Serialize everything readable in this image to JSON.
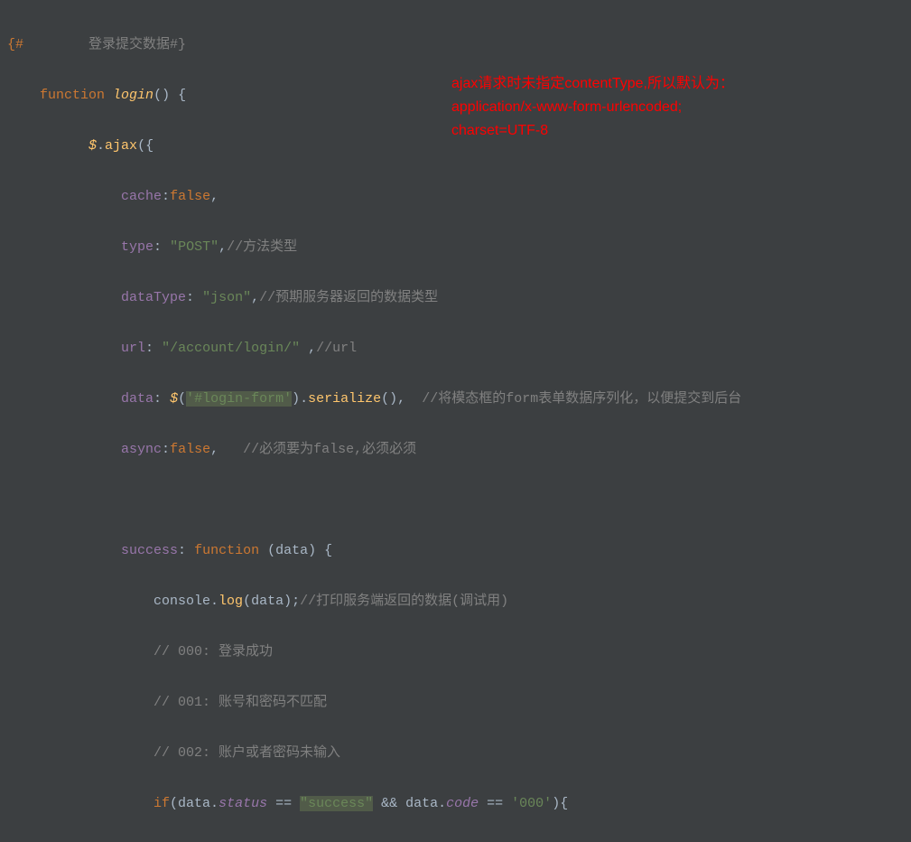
{
  "annotation": {
    "line1": "ajax请求时未指定contentType,所以默认为：",
    "line2": "application/x-www-form-urlencoded;",
    "line3": "charset=UTF-8"
  },
  "code": {
    "l1": {
      "open": "{#",
      "text": "登录提交数据#}"
    },
    "l2": {
      "kw": "function",
      "name": "login",
      "parens": "()",
      "brace": "{"
    },
    "l3": {
      "jq": "$",
      "method": "ajax",
      "paren": "(",
      "brace": "{"
    },
    "l4": {
      "prop": "cache",
      "colon": ":",
      "val": "false",
      "comma": ","
    },
    "l5": {
      "prop": "type",
      "colon": ": ",
      "val": "\"POST\"",
      "comma": ",",
      "comment": "//方法类型"
    },
    "l6": {
      "prop": "dataType",
      "colon": ": ",
      "val": "\"json\"",
      "comma": ",",
      "comment": "//预期服务器返回的数据类型"
    },
    "l7": {
      "prop": "url",
      "colon": ": ",
      "val": "\"/account/login/\"",
      "spc": " ",
      "comma": ",",
      "comment": "//url"
    },
    "l8": {
      "prop": "data",
      "colon": ": ",
      "jq": "$",
      "p1": "(",
      "sel": "'#login-form'",
      "p2": ").",
      "meth": "serialize",
      "p3": "(),",
      "comment": "//将模态框的form表单数据序列化，以便提交到后台"
    },
    "l9": {
      "prop": "async",
      "colon": ":",
      "val": "false",
      "comma": ",",
      "comment": "//必须要为false,必须必须"
    },
    "l11": {
      "prop": "success",
      "colon": ": ",
      "kw": "function",
      "args": "(data)",
      "brace": "{"
    },
    "l12": {
      "obj": "console.",
      "meth": "log",
      "p1": "(data);",
      "comment": "//打印服务端返回的数据(调试用)"
    },
    "l13": {
      "comment": "// 000: 登录成功"
    },
    "l14": {
      "comment": "// 001: 账号和密码不匹配"
    },
    "l15": {
      "comment": "// 002: 账户或者密码未输入"
    },
    "l16": {
      "kw": "if",
      "p1": "(data.",
      "f1": "status",
      "eq1": " == ",
      "s1": "\"success\"",
      "and": " && ",
      "d2": "data.",
      "f2": "code",
      "eq2": " == ",
      "s2": "'000'",
      "p2": ")",
      "brace": "{"
    }
  }
}
